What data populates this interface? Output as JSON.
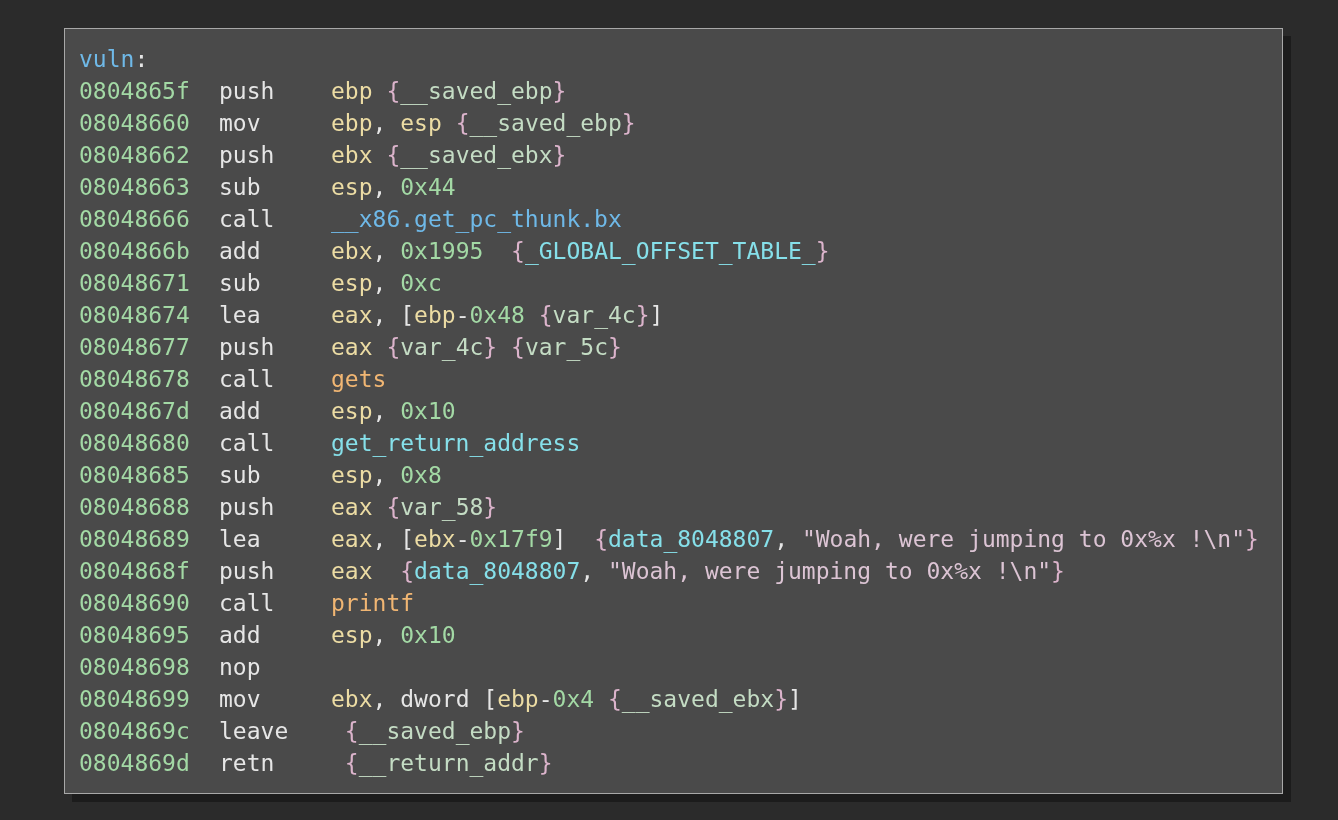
{
  "function_label": {
    "name": "vuln",
    "colon": ":"
  },
  "instructions": [
    {
      "address": "0804865f",
      "mnemonic": "push",
      "operand": [
        {
          "kind": "reg",
          "text": "ebp"
        },
        {
          "kind": "brace",
          "text": " {"
        },
        {
          "kind": "var",
          "text": "__saved_ebp"
        },
        {
          "kind": "brace",
          "text": "}"
        }
      ]
    },
    {
      "address": "08048660",
      "mnemonic": "mov",
      "operand": [
        {
          "kind": "reg",
          "text": "ebp"
        },
        {
          "kind": "punct",
          "text": ", "
        },
        {
          "kind": "reg",
          "text": "esp"
        },
        {
          "kind": "brace",
          "text": " {"
        },
        {
          "kind": "var",
          "text": "__saved_ebp"
        },
        {
          "kind": "brace",
          "text": "}"
        }
      ]
    },
    {
      "address": "08048662",
      "mnemonic": "push",
      "operand": [
        {
          "kind": "reg",
          "text": "ebx"
        },
        {
          "kind": "brace",
          "text": " {"
        },
        {
          "kind": "var",
          "text": "__saved_ebx"
        },
        {
          "kind": "brace",
          "text": "}"
        }
      ]
    },
    {
      "address": "08048663",
      "mnemonic": "sub",
      "operand": [
        {
          "kind": "reg",
          "text": "esp"
        },
        {
          "kind": "punct",
          "text": ", "
        },
        {
          "kind": "num",
          "text": "0x44"
        }
      ]
    },
    {
      "address": "08048666",
      "mnemonic": "call",
      "operand": [
        {
          "kind": "func",
          "text": "__x86.get_pc_thunk.bx"
        }
      ]
    },
    {
      "address": "0804866b",
      "mnemonic": "add",
      "operand": [
        {
          "kind": "reg",
          "text": "ebx"
        },
        {
          "kind": "punct",
          "text": ", "
        },
        {
          "kind": "num",
          "text": "0x1995"
        },
        {
          "kind": "brace",
          "text": "  {"
        },
        {
          "kind": "symbol",
          "text": "_GLOBAL_OFFSET_TABLE_"
        },
        {
          "kind": "brace",
          "text": "}"
        }
      ]
    },
    {
      "address": "08048671",
      "mnemonic": "sub",
      "operand": [
        {
          "kind": "reg",
          "text": "esp"
        },
        {
          "kind": "punct",
          "text": ", "
        },
        {
          "kind": "num",
          "text": "0xc"
        }
      ]
    },
    {
      "address": "08048674",
      "mnemonic": "lea",
      "operand": [
        {
          "kind": "reg",
          "text": "eax"
        },
        {
          "kind": "punct",
          "text": ", ["
        },
        {
          "kind": "reg",
          "text": "ebp"
        },
        {
          "kind": "punct",
          "text": "-"
        },
        {
          "kind": "num",
          "text": "0x48"
        },
        {
          "kind": "brace",
          "text": " {"
        },
        {
          "kind": "var",
          "text": "var_4c"
        },
        {
          "kind": "brace",
          "text": "}"
        },
        {
          "kind": "punct",
          "text": "]"
        }
      ]
    },
    {
      "address": "08048677",
      "mnemonic": "push",
      "operand": [
        {
          "kind": "reg",
          "text": "eax"
        },
        {
          "kind": "brace",
          "text": " {"
        },
        {
          "kind": "var",
          "text": "var_4c"
        },
        {
          "kind": "brace",
          "text": "} {"
        },
        {
          "kind": "var",
          "text": "var_5c"
        },
        {
          "kind": "brace",
          "text": "}"
        }
      ]
    },
    {
      "address": "08048678",
      "mnemonic": "call",
      "operand": [
        {
          "kind": "import",
          "text": "gets"
        }
      ]
    },
    {
      "address": "0804867d",
      "mnemonic": "add",
      "operand": [
        {
          "kind": "reg",
          "text": "esp"
        },
        {
          "kind": "punct",
          "text": ", "
        },
        {
          "kind": "num",
          "text": "0x10"
        }
      ]
    },
    {
      "address": "08048680",
      "mnemonic": "call",
      "operand": [
        {
          "kind": "symbol",
          "text": "get_return_address"
        }
      ]
    },
    {
      "address": "08048685",
      "mnemonic": "sub",
      "operand": [
        {
          "kind": "reg",
          "text": "esp"
        },
        {
          "kind": "punct",
          "text": ", "
        },
        {
          "kind": "num",
          "text": "0x8"
        }
      ]
    },
    {
      "address": "08048688",
      "mnemonic": "push",
      "operand": [
        {
          "kind": "reg",
          "text": "eax"
        },
        {
          "kind": "brace",
          "text": " {"
        },
        {
          "kind": "var",
          "text": "var_58"
        },
        {
          "kind": "brace",
          "text": "}"
        }
      ]
    },
    {
      "address": "08048689",
      "mnemonic": "lea",
      "operand": [
        {
          "kind": "reg",
          "text": "eax"
        },
        {
          "kind": "punct",
          "text": ", ["
        },
        {
          "kind": "reg",
          "text": "ebx"
        },
        {
          "kind": "punct",
          "text": "-"
        },
        {
          "kind": "num",
          "text": "0x17f9"
        },
        {
          "kind": "punct",
          "text": "]"
        },
        {
          "kind": "brace",
          "text": "  {"
        },
        {
          "kind": "symbol",
          "text": "data_8048807"
        },
        {
          "kind": "punct",
          "text": ", "
        },
        {
          "kind": "str",
          "text": "\"Woah, were jumping to 0x%x !\\n\""
        },
        {
          "kind": "brace",
          "text": "}"
        }
      ]
    },
    {
      "address": "0804868f",
      "mnemonic": "push",
      "operand": [
        {
          "kind": "reg",
          "text": "eax"
        },
        {
          "kind": "brace",
          "text": "  {"
        },
        {
          "kind": "symbol",
          "text": "data_8048807"
        },
        {
          "kind": "punct",
          "text": ", "
        },
        {
          "kind": "str",
          "text": "\"Woah, were jumping to 0x%x !\\n\""
        },
        {
          "kind": "brace",
          "text": "}"
        }
      ]
    },
    {
      "address": "08048690",
      "mnemonic": "call",
      "operand": [
        {
          "kind": "import",
          "text": "printf"
        }
      ]
    },
    {
      "address": "08048695",
      "mnemonic": "add",
      "operand": [
        {
          "kind": "reg",
          "text": "esp"
        },
        {
          "kind": "punct",
          "text": ", "
        },
        {
          "kind": "num",
          "text": "0x10"
        }
      ]
    },
    {
      "address": "08048698",
      "mnemonic": "nop"
    },
    {
      "address": "08048699",
      "mnemonic": "mov",
      "operand": [
        {
          "kind": "reg",
          "text": "ebx"
        },
        {
          "kind": "punct",
          "text": ", dword ["
        },
        {
          "kind": "reg",
          "text": "ebp"
        },
        {
          "kind": "punct",
          "text": "-"
        },
        {
          "kind": "num",
          "text": "0x4"
        },
        {
          "kind": "brace",
          "text": " {"
        },
        {
          "kind": "var",
          "text": "__saved_ebx"
        },
        {
          "kind": "brace",
          "text": "}"
        },
        {
          "kind": "punct",
          "text": "]"
        }
      ]
    },
    {
      "address": "0804869c",
      "mnemonic": "leave",
      "operand": [
        {
          "kind": "brace",
          "text": " {"
        },
        {
          "kind": "var",
          "text": "__saved_ebp"
        },
        {
          "kind": "brace",
          "text": "}"
        }
      ]
    },
    {
      "address": "0804869d",
      "mnemonic": "retn",
      "operand": [
        {
          "kind": "brace",
          "text": " {"
        },
        {
          "kind": "var",
          "text": "__return_addr"
        },
        {
          "kind": "brace",
          "text": "}"
        }
      ]
    }
  ]
}
